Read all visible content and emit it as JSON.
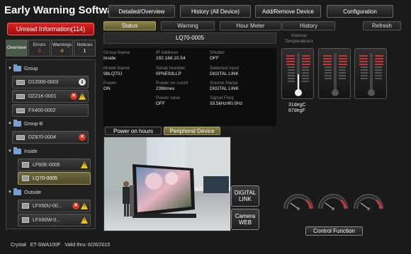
{
  "app": {
    "title": "Early Warning Software"
  },
  "topnav": [
    "Detailed/Overview",
    "History (All Device)",
    "Add/Remove Device",
    "Configuration"
  ],
  "unread": "Unread Information(114)",
  "left_tabs": [
    {
      "label": "Overview",
      "count": ""
    },
    {
      "label": "Errors",
      "count": "3"
    },
    {
      "label": "Warnings",
      "count": "4"
    },
    {
      "label": "Notices",
      "count": "1"
    }
  ],
  "tree": {
    "g1": "Group",
    "d1": "D12000-0003",
    "d2": "DZ21K-0001",
    "d3": "FX400-0002",
    "g2": "Group-B",
    "d4": "DZ870-0004",
    "g3": "Inside",
    "d5": "LF60E-0006",
    "d6": "LQ70-0005",
    "g4": "Outside",
    "d7": "LFX60U-00...",
    "d8": "LFX60W-0..."
  },
  "device_tabs": [
    "Status",
    "Warning",
    "Hour Meter",
    "History"
  ],
  "refresh": "Refresh",
  "device_name": "LQ70-0005",
  "info": {
    "group_name_label": "Group Name",
    "group_name": "Inside",
    "ip_label": "IP Address",
    "ip": "192.168.10.54",
    "shutter_label": "Shutter",
    "shutter": "OFF",
    "model_label": "Model Name",
    "model": "98LQ70J",
    "serial_label": "Serial Number",
    "serial": "0PNE93LLP",
    "input_label": "Selected input",
    "input": "DIGITAL LINK",
    "power_label": "Power",
    "power": "ON",
    "count_label": "Power on count",
    "count": "239times",
    "source_label": "Source Name",
    "source": "DIGITAL LINK",
    "save_label": "Power save",
    "save": "OFF",
    "freq_label": "Signal Freq.",
    "freq": "33.5kHz/60.0Hz"
  },
  "sub_tabs": [
    "Power on hours",
    "Peripheral Device"
  ],
  "side_buttons": {
    "digital_link": "DIGITAL LINK",
    "camera_web": "Camera WEB"
  },
  "temperature": {
    "label": "Internal Temperature1",
    "celsius": "31degC",
    "fahrenheit": "87degF"
  },
  "control_function": "Control Function",
  "statusbar": {
    "name": "Crystal",
    "product": "ET-SWA100F",
    "valid": "Valid thru: 6/26/2015"
  },
  "colors": {
    "accent_red": "#cc2222",
    "active_olive": "#8a8448",
    "warn": "#e8c020"
  }
}
